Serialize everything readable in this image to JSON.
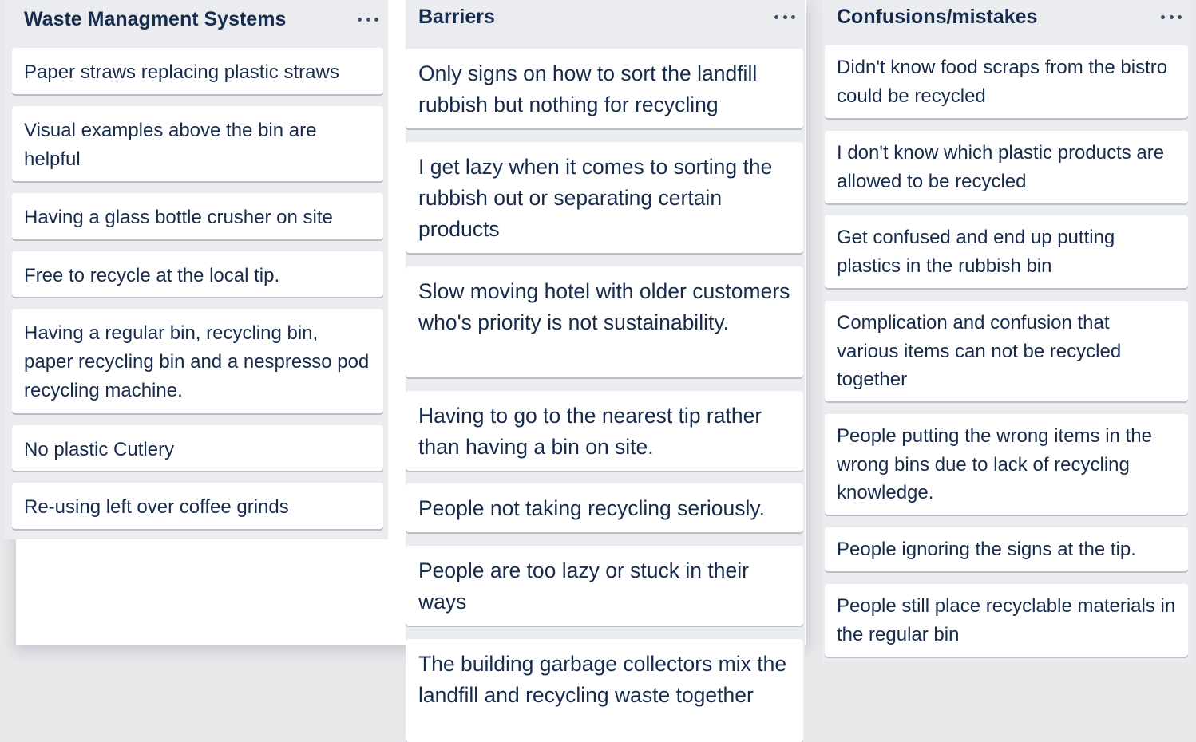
{
  "lists": [
    {
      "title": "Waste Managment Systems",
      "cards": [
        "Paper straws replacing plastic straws",
        "Visual examples above the bin are helpful",
        "Having a glass bottle crusher on site",
        "Free to recycle at the local tip.",
        "Having a regular bin, recycling bin, paper recycling bin and a nespresso pod recycling machine.",
        "No plastic Cutlery",
        "Re-using left over coffee grinds"
      ]
    },
    {
      "title": "Barriers",
      "cards": [
        "Only signs on how to sort the landfill rubbish but nothing for recycling",
        "I get lazy when it comes to sorting the rubbish out or separating certain products",
        "Slow moving hotel with older customers who's priority is not sustainability.",
        "Having to go to the nearest tip rather than having a bin on site.",
        "People not taking recycling seriously.",
        "People are too lazy or stuck in their ways",
        "The building garbage collectors mix the landfill and recycling waste together"
      ]
    },
    {
      "title": "Confusions/mistakes",
      "cards": [
        "Didn't know food scraps from the bistro could be recycled",
        "I don't know which plastic products are allowed to be recycled",
        "Get confused and end up putting plastics in the rubbish bin",
        "Complication and confusion that various items can not be recycled together",
        "People putting the wrong items in the wrong bins due to lack of recycling knowledge.",
        "People ignoring the signs at the tip.",
        "People still place recyclable materials in the regular bin"
      ]
    }
  ],
  "icons": {
    "list_menu": "more-horizontal-icon"
  },
  "colors": {
    "list_background": "#ebecf0",
    "card_background": "#ffffff",
    "text": "#172b4d",
    "board_background": "#e8e8ea"
  }
}
